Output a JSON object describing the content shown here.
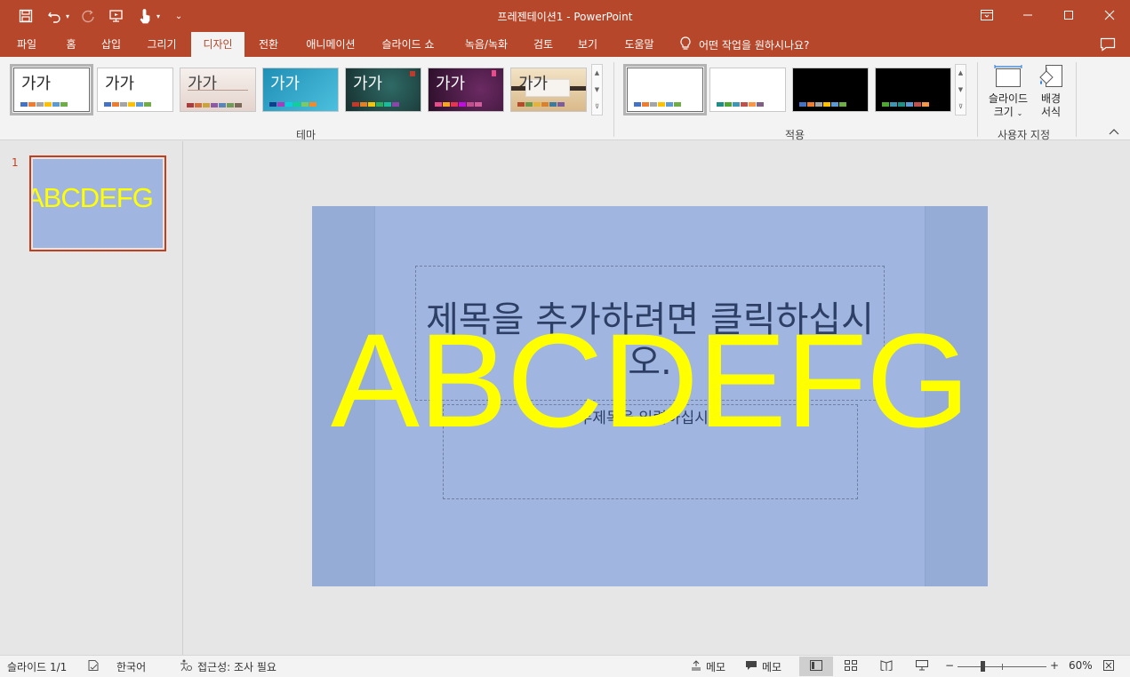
{
  "window": {
    "title": "프레젠테이션1  -  PowerPoint",
    "controls": [
      "restore-ribbon",
      "minimize",
      "maximize",
      "close"
    ]
  },
  "qat": {
    "icons": [
      "save-icon",
      "undo-icon",
      "redo-icon",
      "present-icon",
      "touch-mode-icon",
      "customize-icon"
    ]
  },
  "tabs": [
    {
      "label": "파일",
      "active": false
    },
    {
      "label": "홈",
      "active": false
    },
    {
      "label": "삽입",
      "active": false
    },
    {
      "label": "그리기",
      "active": false
    },
    {
      "label": "디자인",
      "active": true
    },
    {
      "label": "전환",
      "active": false
    },
    {
      "label": "애니메이션",
      "active": false
    },
    {
      "label": "슬라이드 쇼",
      "active": false
    },
    {
      "label": "녹음/녹화",
      "active": false
    },
    {
      "label": "검토",
      "active": false
    },
    {
      "label": "보기",
      "active": false
    },
    {
      "label": "도움말",
      "active": false
    }
  ],
  "tell_me": "어떤 작업을 원하시나요?",
  "ribbon": {
    "themes_group_label": "테마",
    "theme_sample_text": "가가",
    "variants_group_label": "적용",
    "customize_group_label": "사용자 지정",
    "slide_size_label_1": "슬라이드",
    "slide_size_label_2": "크기",
    "bg_format_label_1": "배경",
    "bg_format_label_2": "서식",
    "themes": [
      {
        "name": "office",
        "bg": "#ffffff",
        "text": "#000000",
        "colors": [
          "#4472c4",
          "#ed7d31",
          "#a5a5a5",
          "#ffc000",
          "#5b9bd5",
          "#70ad47"
        ]
      },
      {
        "name": "office-2",
        "bg": "#ffffff",
        "text": "#000000",
        "colors": [
          "#4472c4",
          "#ed7d31",
          "#a5a5a5",
          "#ffc000",
          "#5b9bd5",
          "#70ad47"
        ]
      },
      {
        "name": "facet",
        "bg": "#efe7e3",
        "text": "#404040",
        "colors": [
          "#a93c3c",
          "#d26e3c",
          "#c9a33b",
          "#8e5aa7",
          "#5a85b5",
          "#6f9c5a"
        ]
      },
      {
        "name": "ion",
        "bg": "#2aa6c7",
        "text": "#ffffff",
        "colors": [
          "#0f6fc6",
          "#009dd9",
          "#0bd0d9",
          "#10cf9b",
          "#7cca62",
          "#a5c249"
        ]
      },
      {
        "name": "organic",
        "bg": "#20403f",
        "text": "#ffffff",
        "colors": [
          "#c0392b",
          "#e67e22",
          "#f1c40f",
          "#27ae60",
          "#2980b9",
          "#8e44ad"
        ]
      },
      {
        "name": "berlin",
        "bg": "#4a1f47",
        "text": "#ffffff",
        "colors": [
          "#e84c8b",
          "#f5a623",
          "#f8e71c",
          "#7ed321",
          "#4a90e2",
          "#bd10e0"
        ]
      },
      {
        "name": "wood",
        "bg": "#e9d2ad",
        "text": "#333333",
        "colors": [
          "#b44b2a",
          "#d9822b",
          "#e3b33c",
          "#6a9a48",
          "#3e7a9c",
          "#7c5c9c"
        ]
      }
    ],
    "variants": [
      {
        "bg": "#ffffff",
        "colors": [
          "#4472c4",
          "#ed7d31",
          "#a5a5a5",
          "#ffc000",
          "#5b9bd5",
          "#70ad47"
        ]
      },
      {
        "bg": "#ffffff",
        "colors": [
          "#1f8f86",
          "#4ea72e",
          "#3c96b4",
          "#c0504d",
          "#f79646",
          "#7f6084"
        ]
      },
      {
        "bg": "#000000",
        "colors": [
          "#4472c4",
          "#ed7d31",
          "#a5a5a5",
          "#ffc000",
          "#5b9bd5",
          "#70ad47"
        ]
      },
      {
        "bg": "#000000",
        "colors": [
          "#4ea72e",
          "#3c96b4",
          "#1f8f86",
          "#5b9bd5",
          "#c0504d",
          "#f79646"
        ]
      }
    ]
  },
  "thumbnail": {
    "number": "1",
    "text": "ABCDEFG"
  },
  "slide": {
    "title_placeholder": "제목을 추가하려면 클릭하십시오.",
    "subtitle_placeholder": "부제목을 입력하십시오",
    "wordart_text": "ABCDEFG",
    "bg_color": "#a0b6e0",
    "wordart_color": "#ffff00"
  },
  "status": {
    "slide_counter": "슬라이드 1/1",
    "language": "한국어",
    "accessibility": "접근성: 조사 필요",
    "notes_label": "메모",
    "comments_label": "메모",
    "zoom": "60%"
  }
}
